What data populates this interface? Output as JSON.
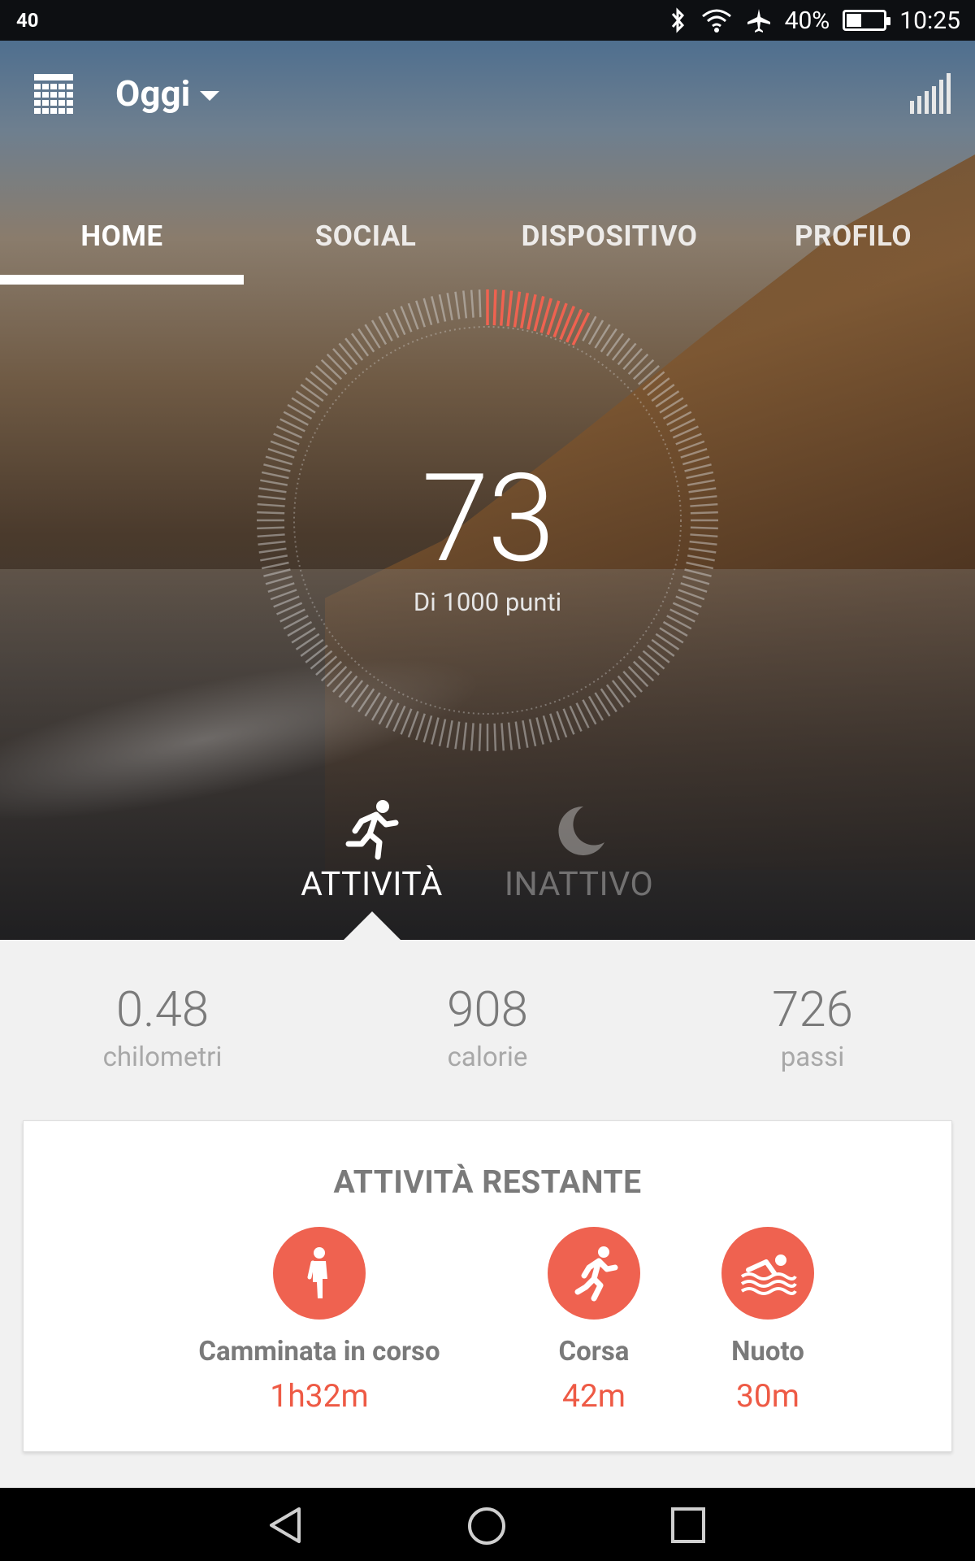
{
  "status_bar": {
    "left_text": "40",
    "battery": "40%",
    "battery_level": 0.4,
    "time": "10:25",
    "icons": [
      "bluetooth-icon",
      "wifi-icon",
      "airplane-icon",
      "battery-icon"
    ]
  },
  "header": {
    "title": "Oggi",
    "calendar_icon": "calendar-icon",
    "chart_icon": "bar-chart-icon"
  },
  "tabs": [
    {
      "label": "HOME",
      "active": true
    },
    {
      "label": "SOCIAL",
      "active": false
    },
    {
      "label": "DISPOSITIVO",
      "active": false
    },
    {
      "label": "PROFILO",
      "active": false
    }
  ],
  "score": {
    "value": "73",
    "subtitle": "Di 1000 punti",
    "progress": 0.073,
    "accent": "#ef6250"
  },
  "modes": {
    "activity": {
      "label": "ATTIVITÀ",
      "icon": "running-icon",
      "active": true
    },
    "inactive": {
      "label": "INATTIVO",
      "icon": "moon-icon",
      "active": false
    }
  },
  "stats": [
    {
      "value": "0.48",
      "label": "chilometri"
    },
    {
      "value": "908",
      "label": "calorie"
    },
    {
      "value": "726",
      "label": "passi"
    }
  ],
  "remaining": {
    "title": "ATTIVITÀ RESTANTE",
    "items": [
      {
        "name": "Camminata in corso",
        "time": "1h32m",
        "icon": "walking-icon"
      },
      {
        "name": "Corsa",
        "time": "42m",
        "icon": "running-icon"
      },
      {
        "name": "Nuoto",
        "time": "30m",
        "icon": "swimming-icon"
      }
    ]
  },
  "nav": {
    "back": "back-icon",
    "home": "home-icon",
    "recents": "recents-icon"
  }
}
